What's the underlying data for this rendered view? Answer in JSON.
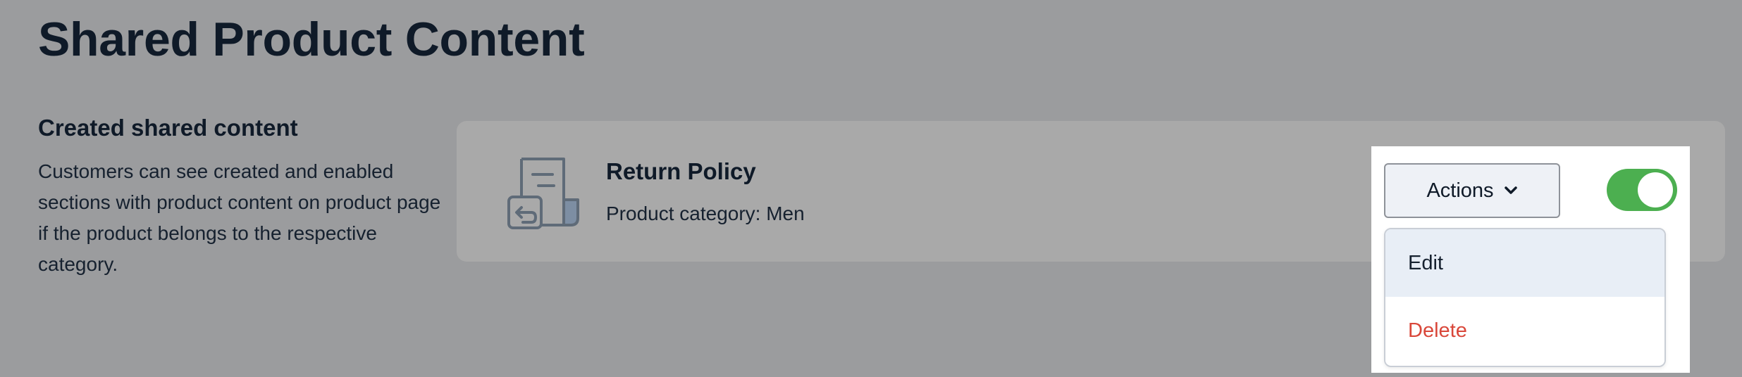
{
  "page": {
    "title": "Shared Product Content"
  },
  "section": {
    "heading": "Created shared content",
    "description": "Customers can see created and enabled sections with product content on product page if the product belongs to the respective category."
  },
  "card": {
    "icon": "return-policy-document-icon",
    "title": "Return Policy",
    "category": "Product category: Men",
    "enabled": true
  },
  "actions": {
    "label": "Actions",
    "icon": "chevron-down-icon",
    "menu": {
      "edit": "Edit",
      "delete": "Delete"
    }
  },
  "colors": {
    "toggle_on": "#4caf50",
    "delete_text": "#d9473a",
    "overlay": "#9b9c9e"
  }
}
